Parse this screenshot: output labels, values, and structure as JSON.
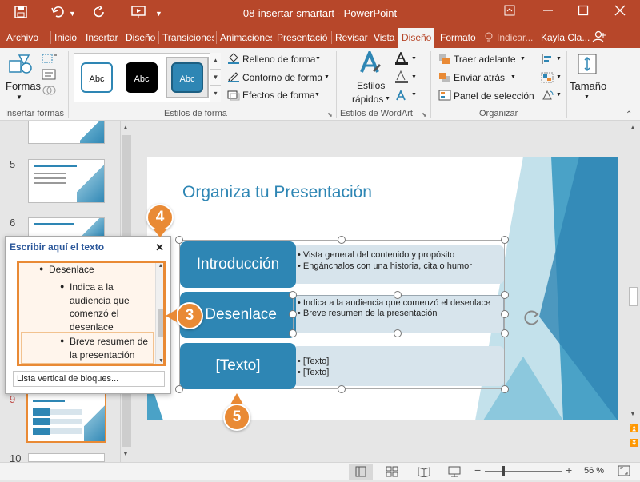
{
  "titlebar": {
    "title": "08-insertar-smartart  -  PowerPoint",
    "save_icon": "save-icon",
    "undo_icon": "undo-icon",
    "redo_icon": "redo-icon",
    "start_icon": "present-icon",
    "customize_icon": "chevron-down-icon",
    "ribbon_display_icon": "ribbon-display-icon",
    "minimize_icon": "minimize-icon",
    "maximize_icon": "maximize-icon",
    "close_icon": "close-icon"
  },
  "tabs": [
    {
      "label": "Archivo"
    },
    {
      "label": "Inicio"
    },
    {
      "label": "Insertar"
    },
    {
      "label": "Diseño"
    },
    {
      "label": "Transiciones"
    },
    {
      "label": "Animaciones"
    },
    {
      "label": "Presentació"
    },
    {
      "label": "Revisar"
    },
    {
      "label": "Vista"
    },
    {
      "label": "Diseño"
    },
    {
      "label": "Formato"
    },
    {
      "label": "Indicar..."
    },
    {
      "label": "Kayla Cla..."
    }
  ],
  "ribbon": {
    "insert_shapes": {
      "shapes_label": "Formas",
      "group_label": "Insertar formas"
    },
    "shape_styles": {
      "gallery": [
        {
          "label": "Abc",
          "bg": "#ffffff",
          "fg": "#111111",
          "border": "#2e86b4"
        },
        {
          "label": "Abc",
          "bg": "#000000",
          "fg": "#ffffff",
          "border": "#000000"
        },
        {
          "label": "Abc",
          "bg": "#2e86b4",
          "fg": "#ffffff",
          "border": "#1d5f82"
        }
      ],
      "fill_label": "Relleno de forma",
      "outline_label": "Contorno de forma",
      "effects_label": "Efectos de forma",
      "group_label": "Estilos de forma"
    },
    "wordart": {
      "quick_styles_label_1": "Estilos",
      "quick_styles_label_2": "rápidos",
      "group_label": "Estilos de WordArt"
    },
    "arrange": {
      "bring_forward": "Traer adelante",
      "send_backward": "Enviar atrás",
      "selection_pane": "Panel de selección",
      "group_label": "Organizar"
    },
    "size": {
      "label": "Tamaño"
    }
  },
  "thumbnails": [
    {
      "number": ""
    },
    {
      "number": "5"
    },
    {
      "number": "6"
    },
    {
      "number": "9"
    },
    {
      "number": "10"
    }
  ],
  "slide": {
    "title": "Organiza tu Presentación",
    "blocks": [
      {
        "heading": "Introducción",
        "bullets": [
          "Vista general del contenido y propósito",
          "Engánchalos con una historia, cita o humor"
        ]
      },
      {
        "heading": "Desenlace",
        "bullets": [
          "Indica a la audiencia que comenzó el desenlace",
          "Breve resumen de la presentación"
        ]
      },
      {
        "heading": "[Texto]",
        "bullets": [
          "[Texto]",
          "[Texto]"
        ]
      }
    ]
  },
  "text_pane": {
    "title": "Escribir aquí el texto",
    "close_icon": "close-icon",
    "items": [
      {
        "text": "Desenlace",
        "level": 1
      },
      {
        "text": "Indica a la audiencia que comenzó el desenlace",
        "level": 2
      },
      {
        "text": "Breve resumen de la presentación",
        "level": 2
      }
    ],
    "footer_link": "Lista vertical de bloques..."
  },
  "callouts": {
    "c3": "3",
    "c4": "4",
    "c5": "5"
  },
  "status": {
    "zoom": "56 %"
  },
  "colors": {
    "accent": "#b7472a",
    "callout": "#e98a35",
    "smartart_blue": "#2e86b4",
    "smartart_list": "#d7e4ec",
    "slide_title": "#2e86b4"
  }
}
